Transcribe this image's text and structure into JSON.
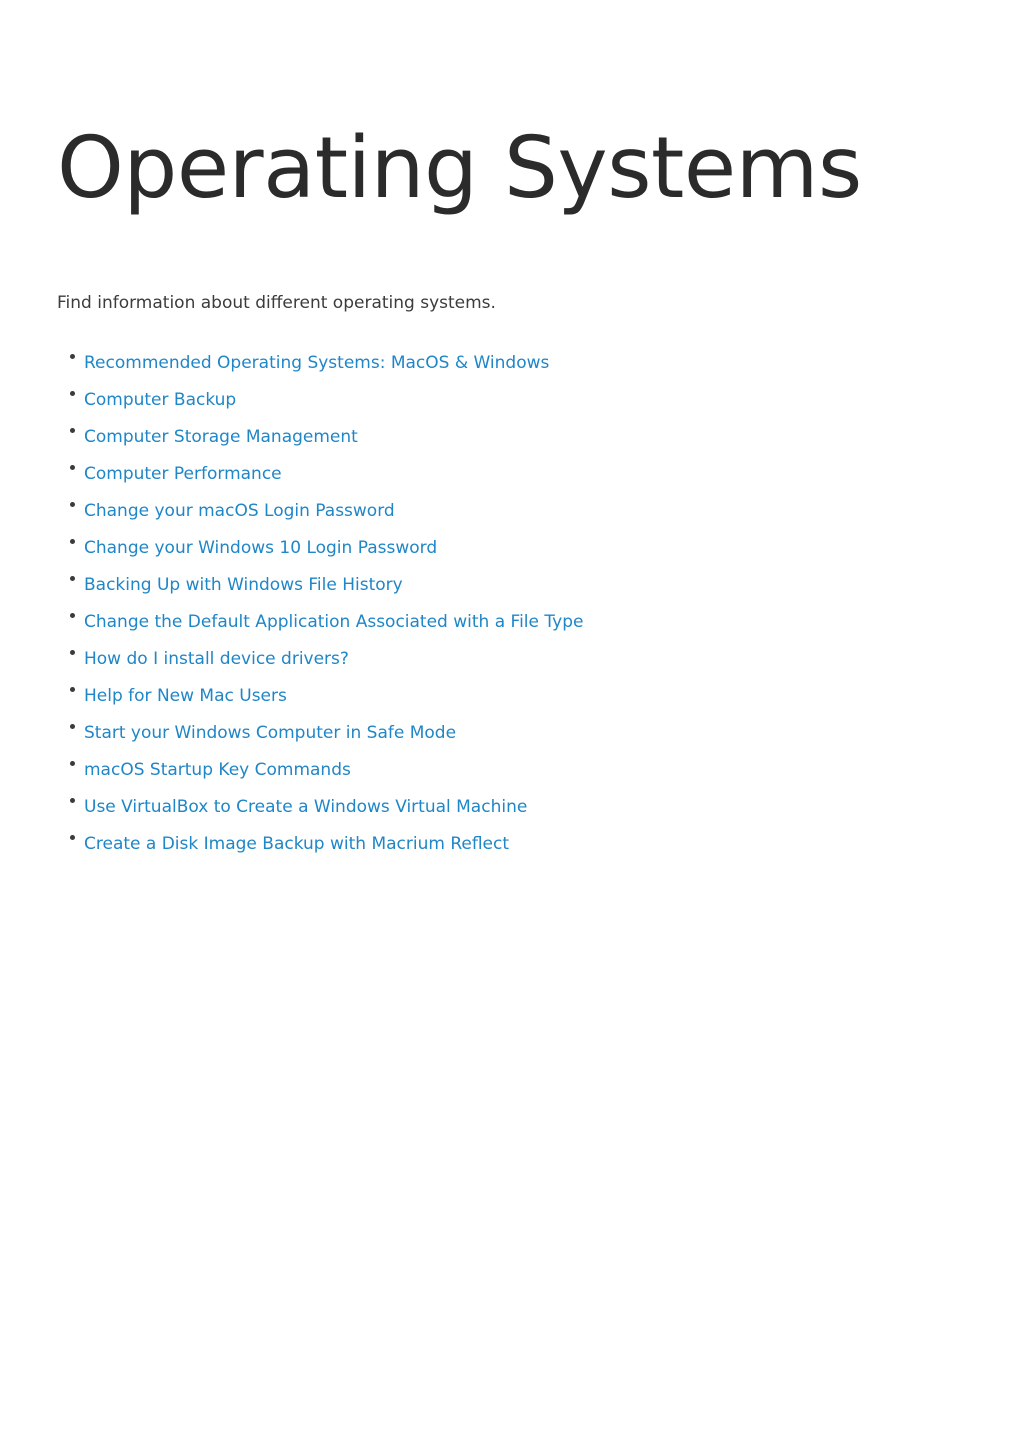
{
  "page": {
    "title": "Operating Systems",
    "intro": "Find information about different operating systems.",
    "background_color": "#ffffff",
    "title_color": "#2b2b2b",
    "text_color": "#3c3c3c",
    "link_color": "#1f86c7",
    "bullet_color": "#3b3b3b"
  },
  "links": [
    {
      "label": "Recommended Operating Systems: MacOS & Windows"
    },
    {
      "label": "Computer Backup"
    },
    {
      "label": "Computer Storage Management"
    },
    {
      "label": "Computer Performance"
    },
    {
      "label": "Change your macOS Login Password"
    },
    {
      "label": "Change your Windows 10 Login Password"
    },
    {
      "label": "Backing Up with Windows File History"
    },
    {
      "label": "Change the Default Application Associated with a File Type"
    },
    {
      "label": "How do I install device drivers?"
    },
    {
      "label": "Help for New Mac Users"
    },
    {
      "label": "Start your Windows Computer in Safe Mode"
    },
    {
      "label": "macOS Startup Key Commands"
    },
    {
      "label": "Use VirtualBox to Create a Windows Virtual Machine"
    },
    {
      "label": "Create a Disk Image Backup with Macrium Reflect"
    }
  ]
}
